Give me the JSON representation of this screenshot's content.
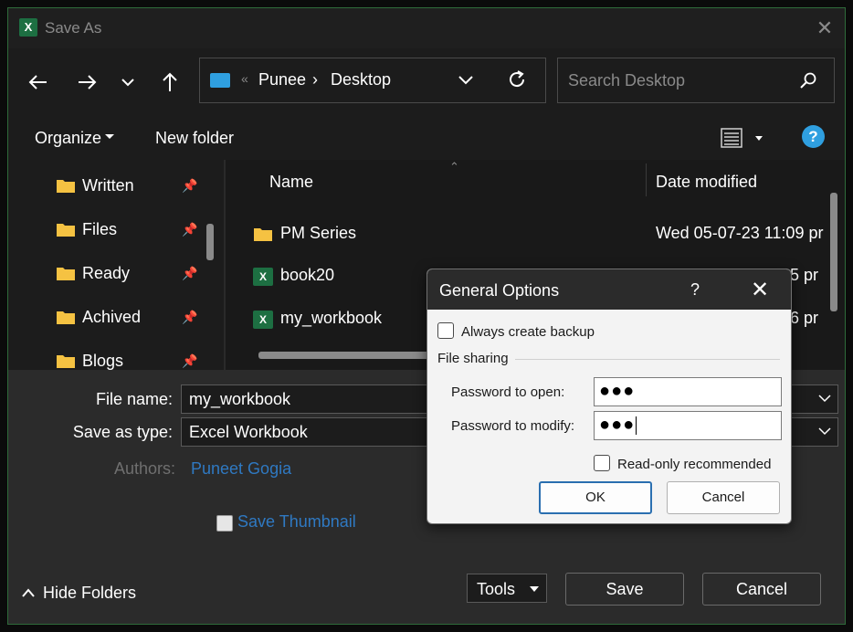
{
  "window": {
    "title": "Save As"
  },
  "address": {
    "crumb_overflow": "«",
    "location": "Punee",
    "separator": "›",
    "folder": "Desktop"
  },
  "search": {
    "placeholder": "Search Desktop"
  },
  "toolbar": {
    "organize": "Organize",
    "new_folder": "New folder",
    "help": "?"
  },
  "nav": {
    "items": [
      {
        "label": "Written"
      },
      {
        "label": "Files"
      },
      {
        "label": "Ready"
      },
      {
        "label": "Achived"
      },
      {
        "label": "Blogs"
      }
    ]
  },
  "files": {
    "columns": {
      "name": "Name",
      "date": "Date modified"
    },
    "rows": [
      {
        "name": "PM Series",
        "date": "Wed 05-07-23 11:09 pr",
        "type": "folder"
      },
      {
        "name": "book20",
        "date": "35 pr",
        "type": "excel"
      },
      {
        "name": "my_workbook",
        "date": "06 pr",
        "type": "excel"
      }
    ]
  },
  "form": {
    "file_name_label": "File name:",
    "file_name_value": "my_workbook",
    "save_type_label": "Save as type:",
    "save_type_value": "Excel Workbook",
    "authors_label": "Authors:",
    "authors_value": "Puneet Gogia",
    "save_thumbnail_label": "Save Thumbnail",
    "hide_folders_label": "Hide Folders",
    "tools_label": "Tools",
    "save_label": "Save",
    "cancel_label": "Cancel"
  },
  "dialog": {
    "title": "General Options",
    "help": "?",
    "always_backup_label": "Always create backup",
    "file_sharing_label": "File sharing",
    "password_open_label": "Password to open:",
    "password_open_value": "●●●",
    "password_modify_label": "Password to modify:",
    "password_modify_value": "●●●",
    "read_only_label": "Read-only recommended",
    "ok_label": "OK",
    "cancel_label": "Cancel"
  },
  "colors": {
    "accent": "#2f9fe0",
    "excel_green": "#1d6f42",
    "link_blue": "#2f79c2"
  }
}
